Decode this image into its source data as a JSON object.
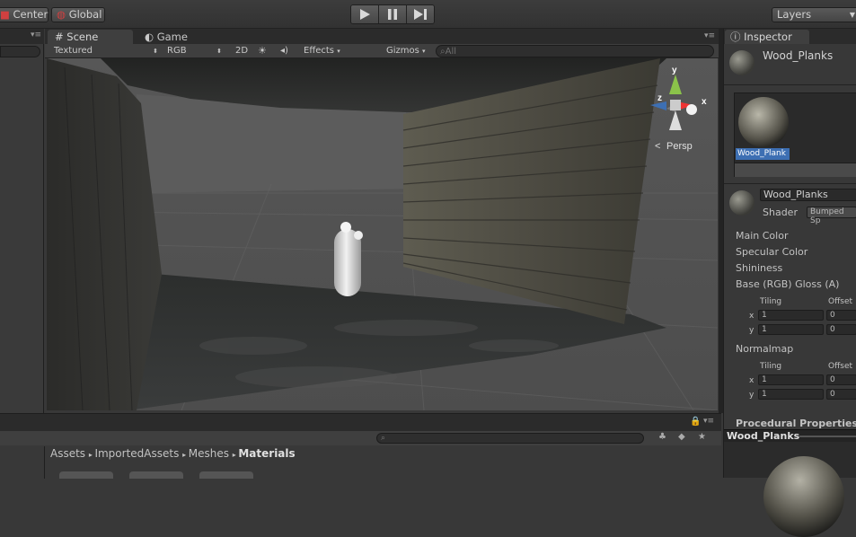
{
  "toolbar": {
    "pivot_label": "Center",
    "space_label": "Global",
    "layers_label": "Layers"
  },
  "scene": {
    "tab_scene": "Scene",
    "tab_game": "Game",
    "draw_mode": "Textured",
    "render_mode": "RGB",
    "mode_2d": "2D",
    "effects": "Effects",
    "gizmos": "Gizmos",
    "search_placeholder": "All",
    "gizmo_y": "y",
    "gizmo_x": "x",
    "gizmo_z": "z",
    "persp": "Persp"
  },
  "inspector": {
    "tab_label": "Inspector",
    "asset_name": "Wood_Planks",
    "preview_tile_label": "Wood_Plank",
    "material_name": "Wood_Planks",
    "shader_label": "Shader",
    "shader_value": "Bumped Sp",
    "props": {
      "main_color": "Main Color",
      "specular": "Specular Color",
      "shininess": "Shininess",
      "base": "Base (RGB) Gloss (A)",
      "normalmap": "Normalmap",
      "procedural": "Procedural Properties"
    },
    "tiling1": {
      "tiling": "Tiling",
      "offset": "Offset",
      "x": "x",
      "y": "y",
      "tx": "1",
      "ty": "1",
      "ox": "0",
      "oy": "0"
    },
    "tiling2": {
      "tiling": "Tiling",
      "offset": "Offset",
      "x": "x",
      "y": "y",
      "tx": "1",
      "ty": "1",
      "ox": "0",
      "oy": "0"
    },
    "preview_title": "Wood_Planks"
  },
  "project": {
    "breadcrumb": [
      "Assets",
      "ImportedAssets",
      "Meshes",
      "Materials"
    ]
  },
  "colors": {
    "accent": "#3d6fb3",
    "panel": "#383838",
    "viewport_bg": "#4a4a4a"
  }
}
